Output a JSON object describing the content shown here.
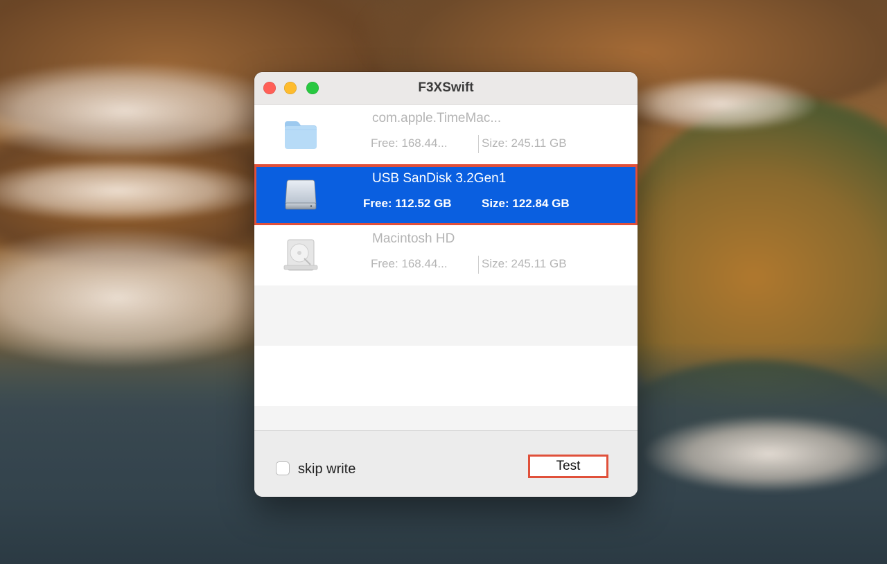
{
  "window": {
    "title": "F3XSwift"
  },
  "drives": [
    {
      "name": "com.apple.TimeMac...",
      "free": "Free: 168.44...",
      "size": "Size: 245.11 GB",
      "icon": "folder-icon",
      "selected": false
    },
    {
      "name": "USB SanDisk 3.2Gen1",
      "free": "Free: 112.52 GB",
      "size": "Size: 122.84 GB",
      "icon": "external-drive-icon",
      "selected": true
    },
    {
      "name": "Macintosh HD",
      "free": "Free: 168.44...",
      "size": "Size: 245.11 GB",
      "icon": "internal-disk-icon",
      "selected": false
    }
  ],
  "options": {
    "skip_write_label": "skip write",
    "skip_write_checked": false
  },
  "actions": {
    "test_label": "Test"
  },
  "colors": {
    "selection": "#0a5fe0",
    "highlight": "#e0503a",
    "close": "#ff5f57",
    "minimize": "#febc2e",
    "maximize": "#28c840"
  }
}
